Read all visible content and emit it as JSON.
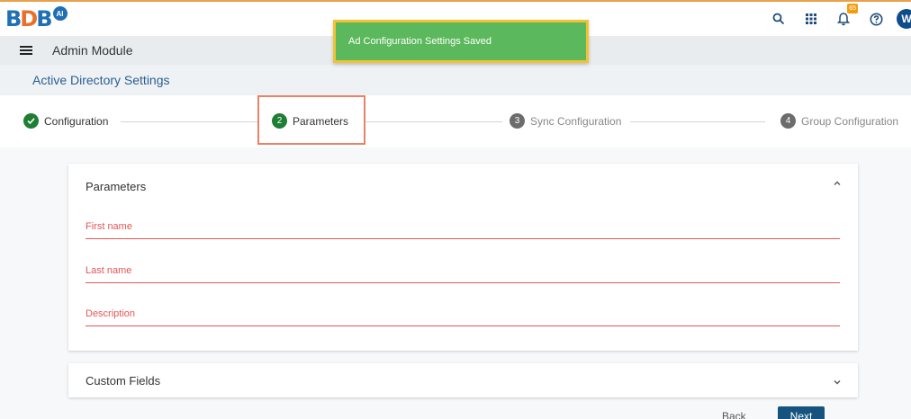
{
  "brand": {
    "logo_text": "BDB",
    "logo_badge": "AI"
  },
  "topbar": {
    "icons": [
      "search-icon",
      "apps-grid-icon",
      "bell-icon",
      "help-icon"
    ],
    "notification_count": "65",
    "user_initial": "W"
  },
  "module": {
    "title": "Admin Module"
  },
  "page": {
    "title": "Active Directory Settings"
  },
  "toast": {
    "message": "Ad Configuration Settings Saved",
    "color": "#5cb85c"
  },
  "stepper": {
    "steps": [
      {
        "number": "1",
        "label": "Configuration",
        "state": "complete"
      },
      {
        "number": "2",
        "label": "Parameters",
        "state": "active"
      },
      {
        "number": "3",
        "label": "Sync Configuration",
        "state": "pending"
      },
      {
        "number": "4",
        "label": "Group Configuration",
        "state": "pending"
      }
    ]
  },
  "parameters": {
    "title": "Parameters",
    "fields": [
      {
        "label": "First name"
      },
      {
        "label": "Last name"
      },
      {
        "label": "Description"
      }
    ]
  },
  "custom_fields": {
    "title": "Custom Fields"
  },
  "actions": {
    "back_label": "Back",
    "next_label": "Next"
  },
  "colors": {
    "primary": "#16537e",
    "success": "#5cb85c",
    "error": "#e35656",
    "step_done": "#1e7e34",
    "step_pending": "#6c6c6c"
  }
}
